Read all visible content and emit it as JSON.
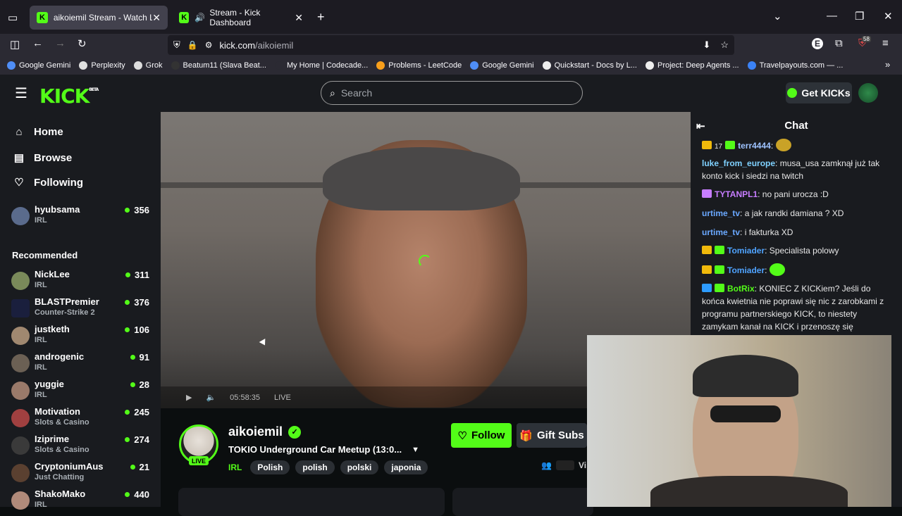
{
  "browser": {
    "tabs": [
      {
        "title": "aikoiemil Stream - Watch Live o",
        "active": true
      },
      {
        "title": "Stream - Kick Dashboard",
        "active": false
      }
    ],
    "url_domain": "kick.com",
    "url_path": "/aikoiemil",
    "extension_badge": "58",
    "bookmarks": [
      "Google Gemini",
      "Perplexity",
      "Grok",
      "Beatum11 (Slava Beat...",
      "My Home | Codecade...",
      "Problems - LeetCode",
      "Google Gemini",
      "Quickstart - Docs by L...",
      "Project: Deep Agents ...",
      "Travelpayouts.com — ..."
    ]
  },
  "header": {
    "logo": "KICK",
    "logo_sup": "BETA",
    "search_placeholder": "Search",
    "get_kicks": "Get KICKs"
  },
  "sidebar": {
    "nav": [
      {
        "label": "Home",
        "icon": "home-icon"
      },
      {
        "label": "Browse",
        "icon": "browse-icon"
      },
      {
        "label": "Following",
        "icon": "heart-icon"
      }
    ],
    "following": [
      {
        "name": "hyubsama",
        "category": "IRL",
        "viewers": "356"
      }
    ],
    "recommended_label": "Recommended",
    "recommended": [
      {
        "name": "NickLee",
        "category": "IRL",
        "viewers": "311"
      },
      {
        "name": "BLASTPremier",
        "category": "Counter-Strike 2",
        "viewers": "376"
      },
      {
        "name": "justketh",
        "category": "IRL",
        "viewers": "106"
      },
      {
        "name": "androgenic",
        "category": "IRL",
        "viewers": "91"
      },
      {
        "name": "yuggie",
        "category": "IRL",
        "viewers": "28"
      },
      {
        "name": "Motivation",
        "category": "Slots & Casino",
        "viewers": "245"
      },
      {
        "name": "Iziprime",
        "category": "Slots & Casino",
        "viewers": "274"
      },
      {
        "name": "CryptoniumAus",
        "category": "Just Chatting",
        "viewers": "21"
      },
      {
        "name": "ShakoMako",
        "category": "IRL",
        "viewers": "440"
      }
    ]
  },
  "stream": {
    "streamer": "aikoiemil",
    "live_label": "LIVE",
    "title": "TOKIO Underground Car Meetup (13:0...",
    "category": "IRL",
    "tags": [
      "Polish",
      "polish",
      "polski",
      "japonia"
    ],
    "follow_label": "Follow",
    "gift_label": "Gift Subs",
    "viewers_label": "Vi",
    "player_time": "05:58:35",
    "player_live": "LIVE"
  },
  "chat": {
    "title": "Chat",
    "messages": [
      {
        "badges": [
          "crown"
        ],
        "prefix": "17",
        "user": "terr4444",
        "color": "#9ec3ff",
        "text": "",
        "emote": "#c9a227"
      },
      {
        "badges": [],
        "user": "luke_from_europe",
        "color": "#7fd1ff",
        "text": "musa_usa zamknął już tak konto kick i siedzi na twitch"
      },
      {
        "badges": [
          "purple"
        ],
        "user": "TYTANPL1",
        "color": "#c77dff",
        "text": "no pani urocza :D"
      },
      {
        "badges": [],
        "user": "urtime_tv",
        "color": "#6aa8ff",
        "text": "a jak randki damiana ? XD"
      },
      {
        "badges": [],
        "user": "urtime_tv",
        "color": "#6aa8ff",
        "text": "i fakturka XD"
      },
      {
        "badges": [
          "crown",
          "green"
        ],
        "user": "Tomiader",
        "color": "#4fa3ff",
        "text": "Specialista polowy"
      },
      {
        "badges": [
          "crown",
          "green"
        ],
        "user": "Tomiader",
        "color": "#4fa3ff",
        "text": "",
        "emote": "#53fc18"
      },
      {
        "badges": [
          "blue",
          "green"
        ],
        "user": "BotRix",
        "color": "#53fc18",
        "text": "KONIEC Z KICKiem? Jeśli do końca kwietnia nie poprawi się nic z zarobkami z programu partnerskiego KICK, to niestety zamykam kanał na KICK i przenoszę się"
      }
    ]
  }
}
